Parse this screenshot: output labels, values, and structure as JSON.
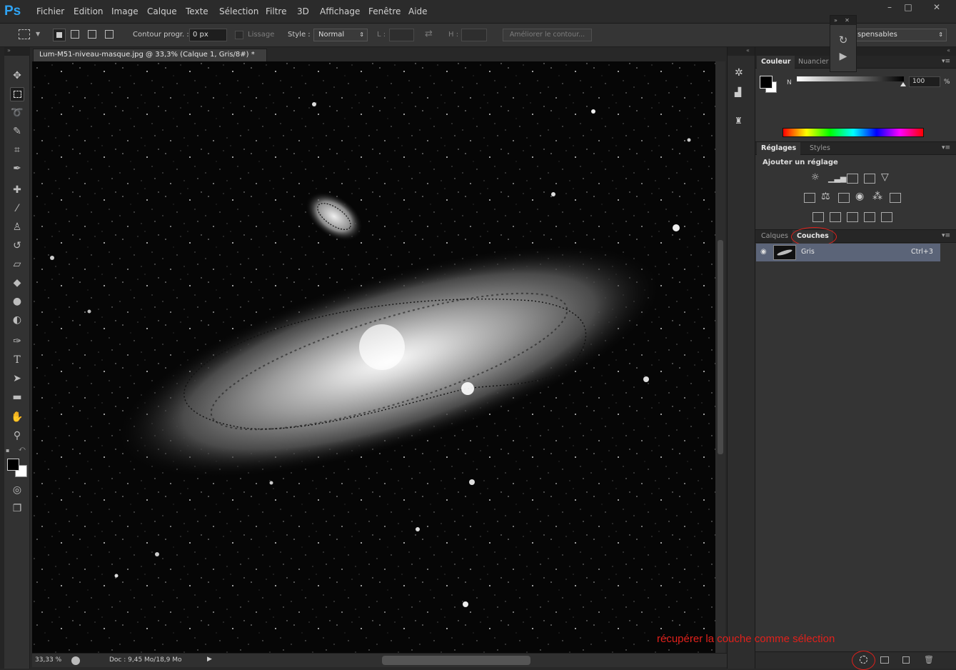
{
  "app": {
    "logo": "Ps"
  },
  "menu": [
    "Fichier",
    "Edition",
    "Image",
    "Calque",
    "Texte",
    "Sélection",
    "Filtre",
    "3D",
    "Affichage",
    "Fenêtre",
    "Aide"
  ],
  "window_controls": [
    "–",
    "□",
    "✕"
  ],
  "options": {
    "feather_label": "Contour progr. :",
    "feather_value": "0 px",
    "antialias_label": "Lissage",
    "style_label": "Style :",
    "style_value": "Normal",
    "width_label": "L :",
    "height_label": "H :",
    "refine_label": "Améliorer le contour...",
    "workspace_value": "spensables"
  },
  "document": {
    "tab_title": "Lum-M51-niveau-masque.jpg @ 33,3% (Calque 1, Gris/8#) *"
  },
  "status": {
    "zoom": "33,33 %",
    "doc_size": "Doc : 9,45 Mo/18,9 Mo"
  },
  "color_panel": {
    "tabs": [
      "Couleur",
      "Nuancier"
    ],
    "channel_label": "N",
    "value": "100",
    "unit": "%"
  },
  "adjustments_panel": {
    "tabs": [
      "Réglages",
      "Styles"
    ],
    "title": "Ajouter un réglage"
  },
  "layers_panel": {
    "tabs": [
      "Calques",
      "Couches"
    ],
    "channel": {
      "name": "Gris",
      "shortcut": "Ctrl+3"
    }
  },
  "annotation": "récupérer la couche comme sélection",
  "colors": {
    "accent": "#2fa3f3",
    "annotation": "#e1201b",
    "channel_row": "#5b6478"
  },
  "icons": [
    "move-icon",
    "marquee-icon",
    "lasso-icon",
    "quick-select-icon",
    "crop-icon",
    "eyedropper-icon",
    "healing-icon",
    "brush-icon",
    "stamp-icon",
    "history-brush-icon",
    "eraser-icon",
    "bucket-icon",
    "blur-icon",
    "dodge-icon",
    "pen-icon",
    "type-icon",
    "path-select-icon",
    "shape-icon",
    "hand-icon",
    "zoom-icon"
  ]
}
